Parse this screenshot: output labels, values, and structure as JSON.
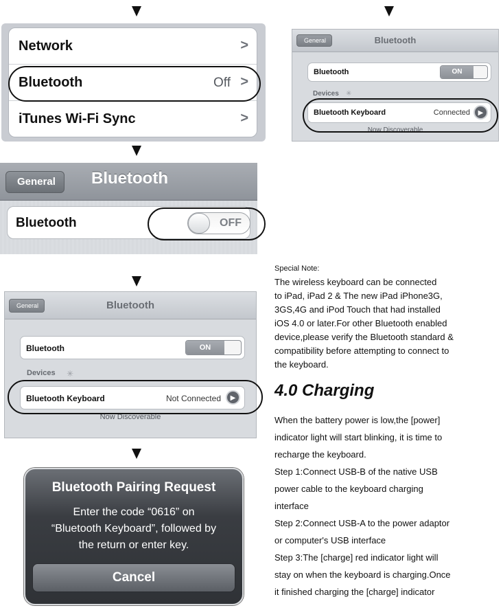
{
  "settings_list": {
    "rows": [
      {
        "label": "Network",
        "value": "",
        "chevron": ">"
      },
      {
        "label": "Bluetooth",
        "value": "Off",
        "chevron": ">"
      },
      {
        "label": "iTunes Wi-Fi Sync",
        "value": "",
        "chevron": ">"
      }
    ]
  },
  "bt_off_screen": {
    "back_label": "General",
    "title": "Bluetooth",
    "row_label": "Bluetooth",
    "toggle_text": "OFF"
  },
  "bt_connected_screen": {
    "back_label": "General",
    "title": "Bluetooth",
    "row_label": "Bluetooth",
    "toggle_text": "ON",
    "section_label": "Devices",
    "device_label": "Bluetooth Keyboard",
    "device_status": "Connected",
    "footer": "Now Discoverable"
  },
  "bt_not_connected_screen": {
    "back_label": "General",
    "title": "Bluetooth",
    "row_label": "Bluetooth",
    "toggle_text": "ON",
    "section_label": "Devices",
    "device_label": "Bluetooth Keyboard",
    "device_status": "Not Connected",
    "footer": "Now Discoverable"
  },
  "pairing_dialog": {
    "title": "Bluetooth Pairing Request",
    "message_lines": [
      "Enter the code “0616” on",
      "“Bluetooth Keyboard”, followed by",
      "the return or enter key."
    ],
    "button_label": "Cancel"
  },
  "special_note": {
    "heading": "Special Note:",
    "lines": [
      "The wireless keyboard can be connected",
      "to iPad, iPad 2 & The new iPad  iPhone3G,",
      "3GS,4G and iPod Touch that  had installed",
      "iOS 4.0 or later.For other  Bluetooth enabled",
      "device,please verify the  Bluetooth standard &",
      "compatibility before  attempting to connect to",
      "the keyboard."
    ]
  },
  "charging": {
    "heading": "4.0 Charging",
    "lines": [
      "When the battery power is low,the [power]",
      "indicator light will start blinking,  it is time to",
      "recharge the keyboard.",
      "Step 1:Connect USB-B of the native USB",
      "power cable to the keyboard charging",
      "interface",
      "Step 2:Connect USB-A to the power adaptor",
      "or computer's USB interface",
      "Step 3:The [charge] red indicator light will",
      "stay on when the keyboard is charging.Once",
      "it finished charging the [charge] indicator"
    ]
  },
  "icons": {
    "down_arrow": "down-arrow-icon",
    "chevron": "chevron-right-icon",
    "disclosure": "disclosure-icon",
    "spinner": "spinner-icon"
  }
}
